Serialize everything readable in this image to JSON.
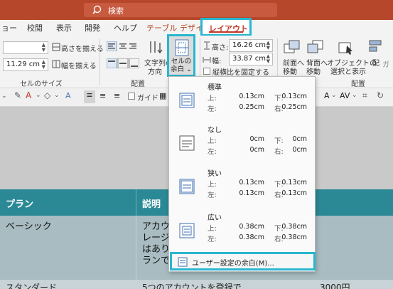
{
  "search": {
    "text": "検索"
  },
  "tabs": [
    {
      "label": "ョー"
    },
    {
      "label": "校閲"
    },
    {
      "label": "表示"
    },
    {
      "label": "開発"
    },
    {
      "label": "ヘルプ"
    },
    {
      "label": "テーブル デザイン"
    },
    {
      "label": "レイアウト"
    }
  ],
  "ribbon": {
    "cell_size": {
      "height_value": "",
      "width_value": "11.29 cm",
      "distribute_rows": "高さを揃える",
      "distribute_cols": "幅を揃える",
      "group_label": "セルのサイズ"
    },
    "alignment": {
      "text_direction_label_1": "文字列の",
      "text_direction_label_2": "方向",
      "cell_margins_label_1": "セルの",
      "cell_margins_label_2": "余白",
      "group_label": "配置"
    },
    "table_size": {
      "height_label": "高さ:",
      "height_value": "16.26 cm",
      "width_label": "幅:",
      "width_value": "33.87 cm",
      "lock_aspect": "縦横比を固定する"
    },
    "arrange": {
      "bring_forward_1": "前面へ",
      "bring_forward_2": "移動",
      "send_backward_1": "背面へ",
      "send_backward_2": "移動",
      "selection_pane_1": "オブジェクトの",
      "selection_pane_2": "選択と表示",
      "align_1": "配",
      "align_2": "ガ",
      "group_label": "配置"
    }
  },
  "format_bar": {
    "guides_label": "ガイド"
  },
  "table": {
    "headers": [
      "プラン",
      "説明"
    ],
    "rows": [
      {
        "plan": "ベーシック",
        "desc_lines": [
          "アカウ",
          "レージ",
          "はあり",
          "ランで"
        ]
      }
    ],
    "next_row_fragment": [
      "スタンダード",
      "5つのアカウントを登録で",
      "3000円"
    ]
  },
  "dropdown": {
    "options": [
      {
        "name": "標準",
        "top_label": "上:",
        "top": "0.13cm",
        "bottom_label": "下:",
        "bottom": "0.13cm",
        "left_label": "左:",
        "left": "0.25cm",
        "right_label": "右:",
        "right": "0.25cm"
      },
      {
        "name": "なし",
        "top_label": "上:",
        "top": "0cm",
        "bottom_label": "下:",
        "bottom": "0cm",
        "left_label": "左:",
        "left": "0cm",
        "right_label": "右:",
        "right": "0cm"
      },
      {
        "name": "狭い",
        "top_label": "上:",
        "top": "0.13cm",
        "bottom_label": "下:",
        "bottom": "0.13cm",
        "left_label": "左:",
        "left": "0.13cm",
        "right_label": "右:",
        "right": "0.13cm"
      },
      {
        "name": "広い",
        "top_label": "上:",
        "top": "0.38cm",
        "bottom_label": "下:",
        "bottom": "0.38cm",
        "left_label": "左:",
        "left": "0.38cm",
        "right_label": "右:",
        "right": "0.38cm"
      }
    ],
    "custom_label": "ユーザー設定の余白(M)..."
  },
  "colors": {
    "title_bar": "#b7472a",
    "highlight": "#29b6d0",
    "active_tab_text": "#c0392b",
    "table_header": "#2b8996"
  }
}
